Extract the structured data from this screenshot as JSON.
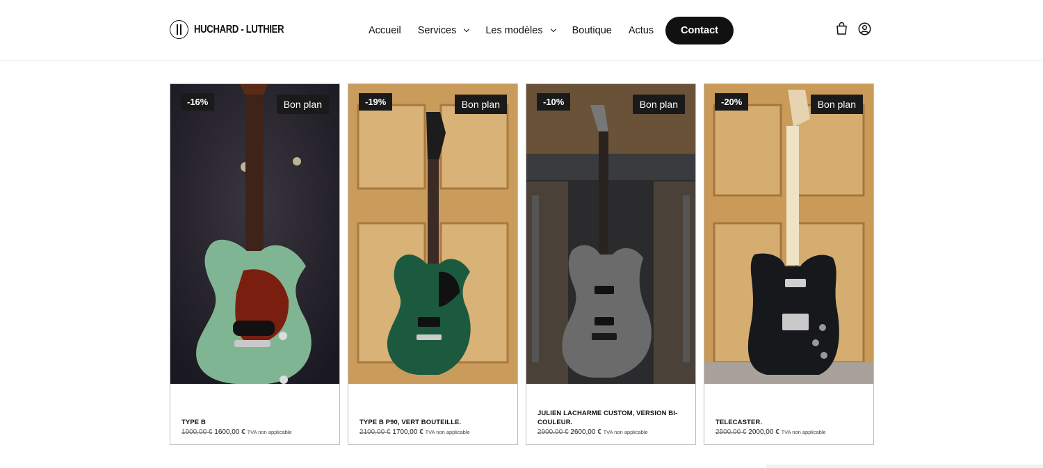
{
  "brand": {
    "name": "HUCHARD - LUTHIER"
  },
  "nav": {
    "items": [
      {
        "label": "Accueil",
        "dropdown": false
      },
      {
        "label": "Services",
        "dropdown": true
      },
      {
        "label": "Les modèles",
        "dropdown": true
      },
      {
        "label": "Boutique",
        "dropdown": false
      },
      {
        "label": "Actus",
        "dropdown": false
      }
    ],
    "contact": "Contact"
  },
  "icons": [
    "bag-icon",
    "user-icon"
  ],
  "products": [
    {
      "discount": "-16%",
      "badge": "Bon plan",
      "name": "TYPE B",
      "old_price": "1900,00 €",
      "price": "1600,00 €",
      "vat": "TVA non applicable",
      "body_color": "#7fb592"
    },
    {
      "discount": "-19%",
      "badge": "Bon plan",
      "name": "TYPE B P90, VERT BOUTEILLE.",
      "old_price": "2100,00 €",
      "price": "1700,00 €",
      "vat": "TVA non applicable",
      "body_color": "#1c5a40"
    },
    {
      "discount": "-10%",
      "badge": "Bon plan",
      "name": "JULIEN LACHARME CUSTOM, VERSION BI-COULEUR.",
      "old_price": "2900,00 €",
      "price": "2600,00 €",
      "vat": "TVA non applicable",
      "body_color": "#6b6b6b"
    },
    {
      "discount": "-20%",
      "badge": "Bon plan",
      "name": "TELECASTER.",
      "old_price": "2500,00 €",
      "price": "2000,00 €",
      "vat": "TVA non applicable",
      "body_color": "#16181c"
    }
  ],
  "colors": {
    "accent": "#111111",
    "badge_bg": "#1a1a1a"
  }
}
